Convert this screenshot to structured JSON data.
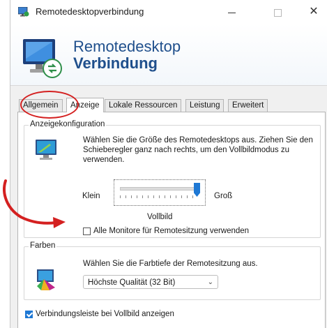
{
  "window": {
    "title": "Remotedesktopverbindung",
    "controls": {
      "minimize": "—",
      "maximize": "□",
      "close": "✕"
    }
  },
  "banner": {
    "line1": "Remotedesktop",
    "line2": "Verbindung"
  },
  "tabs": [
    {
      "label": "Allgemein",
      "active": false,
      "highlighted": true
    },
    {
      "label": "Anzeige",
      "active": true
    },
    {
      "label": "Lokale Ressourcen",
      "active": false
    },
    {
      "label": "Leistung",
      "active": false
    },
    {
      "label": "Erweitert",
      "active": false
    }
  ],
  "display_config": {
    "legend": "Anzeigekonfiguration",
    "description": "Wählen Sie die Größe des Remotedesktops aus. Ziehen Sie den Schieberegler ganz nach rechts, um den Vollbildmodus zu verwenden.",
    "slider": {
      "min_label": "Klein",
      "max_label": "Groß",
      "value_label": "Vollbild",
      "value": 1.0
    },
    "all_monitors": {
      "label": "Alle Monitore für Remotesitzung verwenden",
      "checked": false
    }
  },
  "colors": {
    "legend": "Farben",
    "description": "Wählen Sie die Farbtiefe der Remotesitzung aus.",
    "color_depth_selected": "Höchste Qualität (32 Bit)"
  },
  "connection_bar": {
    "label": "Verbindungsleiste bei Vollbild anzeigen",
    "checked": true
  },
  "annotations": {
    "highlight_color": "#d42020"
  },
  "theme": {
    "accent": "#1e78d4",
    "banner_text": "#1f4f8c"
  }
}
